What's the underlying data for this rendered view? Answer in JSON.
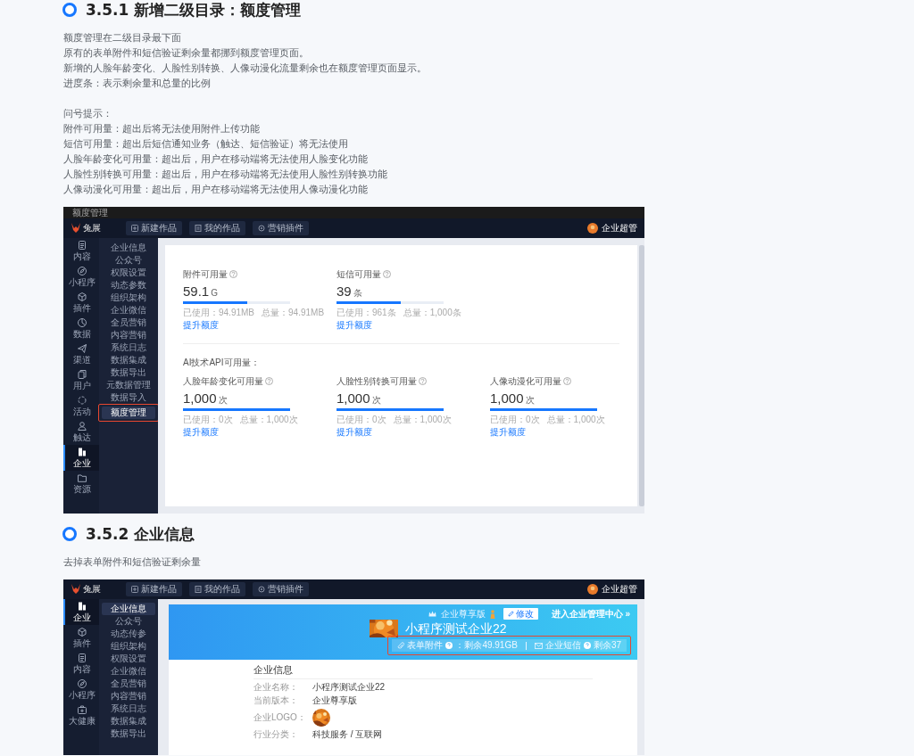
{
  "section_1": {
    "heading": "3.5.1 新增二级目录：额度管理",
    "paragraphs": [
      [
        "额度管理在二级目录最下面",
        "原有的表单附件和短信验证剩余量都挪到额度管理页面。",
        "新增的人脸年龄变化、人脸性别转换、人像动漫化流量剩余也在额度管理页面显示。",
        "进度条：表示剩余量和总量的比例"
      ],
      [
        "问号提示：",
        "附件可用量：超出后将无法使用附件上传功能",
        "短信可用量：超出后短信通知业务（触达、短信验证）将无法使用",
        "人脸年龄变化可用量：超出后，用户在移动端将无法使用人脸变化功能",
        "人脸性别转换可用量：超出后，用户在移动端将无法使用人脸性别转换功能",
        "人像动漫化可用量：超出后，用户在移动端将无法使用人像动漫化功能"
      ]
    ],
    "screenshot": {
      "window_title": "额度管理",
      "logo_text": "兔展",
      "toolbar": [
        "新建作品",
        "我的作品",
        "营销插件"
      ],
      "user": "企业超管",
      "rail": [
        {
          "label": "内容",
          "selected": false
        },
        {
          "label": "小程序",
          "selected": false
        },
        {
          "label": "插件",
          "selected": false
        },
        {
          "label": "数据",
          "selected": false
        },
        {
          "label": "渠道",
          "selected": false
        },
        {
          "label": "用户",
          "selected": false
        },
        {
          "label": "活动",
          "selected": false
        },
        {
          "label": "触达",
          "selected": false
        },
        {
          "label": "企业",
          "selected": true
        },
        {
          "label": "资源",
          "selected": false
        }
      ],
      "menu": [
        {
          "label": "企业信息",
          "selected": false,
          "highlighted": false
        },
        {
          "label": "公众号",
          "selected": false,
          "highlighted": false
        },
        {
          "label": "权限设置",
          "selected": false,
          "highlighted": false
        },
        {
          "label": "动态参数",
          "selected": false,
          "highlighted": false
        },
        {
          "label": "组织架构",
          "selected": false,
          "highlighted": false
        },
        {
          "label": "企业微信",
          "selected": false,
          "highlighted": false
        },
        {
          "label": "全员营销",
          "selected": false,
          "highlighted": false
        },
        {
          "label": "内容营销",
          "selected": false,
          "highlighted": false
        },
        {
          "label": "系统日志",
          "selected": false,
          "highlighted": false
        },
        {
          "label": "数据集成",
          "selected": false,
          "highlighted": false
        },
        {
          "label": "数据导出",
          "selected": false,
          "highlighted": false
        },
        {
          "label": "元数据管理",
          "selected": false,
          "highlighted": false
        },
        {
          "label": "数据导入",
          "selected": false,
          "highlighted": false
        },
        {
          "label": "额度管理",
          "selected": true,
          "highlighted": true
        }
      ],
      "quotas": [
        {
          "label": "附件可用量",
          "value": "59.1",
          "unit": "G",
          "level": 0.6,
          "used": "已使用：94.91MB",
          "total": "总量：94.91MB",
          "link": "提升额度"
        },
        {
          "label": "短信可用量",
          "value": "39",
          "unit": "条",
          "level": 0.6,
          "used": "已使用：961条",
          "total": "总量：1,000条",
          "link": "提升额度"
        }
      ],
      "ai_title": "AI技术API可用量：",
      "ai_quotas": [
        {
          "label": "人脸年龄变化可用量",
          "value": "1,000",
          "unit": "次",
          "level": 1,
          "used": "已使用：0次",
          "total": "总量：1,000次",
          "link": "提升额度"
        },
        {
          "label": "人脸性别转换可用量",
          "value": "1,000",
          "unit": "次",
          "level": 1,
          "used": "已使用：0次",
          "total": "总量：1,000次",
          "link": "提升额度"
        },
        {
          "label": "人像动漫化可用量",
          "value": "1,000",
          "unit": "次",
          "level": 1,
          "used": "已使用：0次",
          "total": "总量：1,000次",
          "link": "提升额度"
        }
      ]
    }
  },
  "section_2": {
    "heading": "3.5.2 企业信息",
    "paragraphs": [
      [
        "去掉表单附件和短信验证剩余量"
      ]
    ],
    "screenshot": {
      "logo_text": "兔展",
      "toolbar": [
        "新建作品",
        "我的作品",
        "营销插件"
      ],
      "user": "企业超管",
      "rail": [
        {
          "label": "企业",
          "selected": true
        },
        {
          "label": "插件",
          "selected": false
        },
        {
          "label": "内容",
          "selected": false
        },
        {
          "label": "小程序",
          "selected": false
        },
        {
          "label": "大健康",
          "selected": false
        }
      ],
      "menu": [
        {
          "label": "企业信息",
          "selected": true
        },
        {
          "label": "公众号",
          "selected": false
        },
        {
          "label": "动态传参",
          "selected": false
        },
        {
          "label": "组织架构",
          "selected": false
        },
        {
          "label": "权限设置",
          "selected": false
        },
        {
          "label": "企业微信",
          "selected": false
        },
        {
          "label": "全员营销",
          "selected": false
        },
        {
          "label": "内容营销",
          "selected": false
        },
        {
          "label": "系统日志",
          "selected": false
        },
        {
          "label": "数据集成",
          "selected": false
        },
        {
          "label": "数据导出",
          "selected": false
        }
      ],
      "banner": {
        "edition": "企业尊享版",
        "edit_button": "修改",
        "manage_link": "进入企业管理中心 »",
        "company_name": "小程序测试企业22",
        "stats_highlighted": true,
        "stats": [
          {
            "label": "表单附件",
            "value": "：剩余49.91GB"
          },
          {
            "label": "企业短信",
            "value": "剩余37"
          }
        ]
      },
      "card": {
        "title": "企业信息",
        "fields": [
          {
            "label": "企业名称：",
            "kind": "text",
            "value": "小程序测试企业22"
          },
          {
            "label": "当前版本：",
            "kind": "text",
            "value": "企业尊享版"
          },
          {
            "label": "企业LOGO：",
            "kind": "picture"
          },
          {
            "label": "行业分类：",
            "kind": "text",
            "value": "科技服务 / 互联网"
          }
        ]
      }
    }
  }
}
